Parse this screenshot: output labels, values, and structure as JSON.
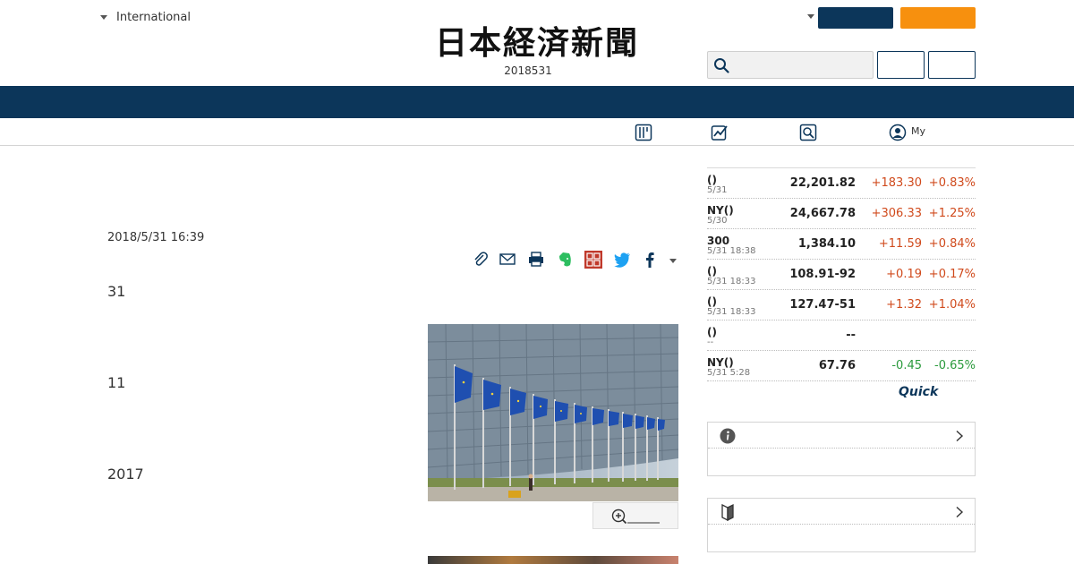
{
  "header": {
    "edition_label": "International",
    "logo_text": "日本経済新聞",
    "date": "2018531",
    "search_placeholder": ""
  },
  "subnav": {
    "my_label": "My"
  },
  "article": {
    "date": "2018/5/31 16:39",
    "paragraphs": [
      "31",
      "11",
      "2017"
    ]
  },
  "market": {
    "rows": [
      {
        "name": "()",
        "time": "5/31",
        "value": "22,201.82",
        "change": "+183.30",
        "pct": "+0.83%",
        "dir": "up"
      },
      {
        "name": "NY()",
        "time": "5/30",
        "value": "24,667.78",
        "change": "+306.33",
        "pct": "+1.25%",
        "dir": "up"
      },
      {
        "name": "300",
        "time": "5/31 18:38",
        "value": "1,384.10",
        "change": "+11.59",
        "pct": "+0.84%",
        "dir": "up"
      },
      {
        "name": "()",
        "time": "5/31 18:33",
        "value": "108.91-92",
        "change": "+0.19",
        "pct": "+0.17%",
        "dir": "up"
      },
      {
        "name": "()",
        "time": "5/31 18:33",
        "value": "127.47-51",
        "change": "+1.32",
        "pct": "+1.04%",
        "dir": "up"
      },
      {
        "name": "()",
        "time": "--",
        "value": "--",
        "change": "",
        "pct": "",
        "dir": "none"
      },
      {
        "name": "NY()",
        "time": "5/31 5:28",
        "value": "67.76",
        "change": "-0.45",
        "pct": "-0.65%",
        "dir": "down"
      }
    ],
    "source_logo": "Quick"
  },
  "colors": {
    "navy": "#0c365a",
    "orange": "#f7900e",
    "up": "#d04a1c",
    "down": "#2a9a3c"
  }
}
